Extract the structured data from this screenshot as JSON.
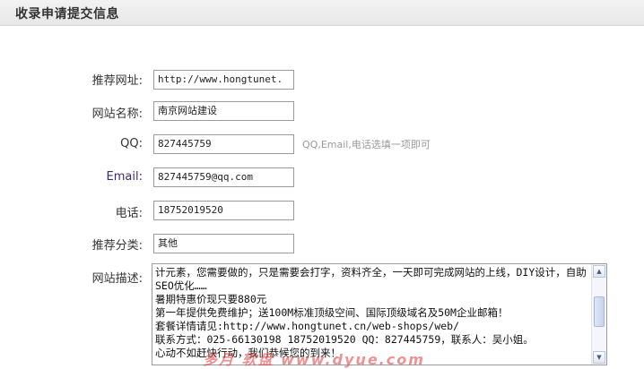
{
  "header": {
    "title": "收录申请提交信息"
  },
  "form": {
    "url": {
      "label": "推荐网址:",
      "value": "http://www.hongtunet."
    },
    "name": {
      "label": "网站名称:",
      "value": "南京网站建设"
    },
    "qq": {
      "label": "QQ:",
      "value": "827445759",
      "hint": "QQ,Email,电话选填一项即可"
    },
    "email": {
      "label": "Email:",
      "value": "827445759@qq.com"
    },
    "phone": {
      "label": "电话:",
      "value": "18752019520"
    },
    "category": {
      "label": "推荐分类:",
      "value": "其他"
    },
    "description": {
      "label": "网站描述:",
      "value": "计元素，您需要做的，只是需要会打字，资料齐全，一天即可完成网站的上线，DIY设计，自助SEO优化……\n暑期特惠价现只要880元\n第一年提供免费维护；送100M标准顶级空间、国际顶级域名及50M企业邮箱！\n套餐详情请见:http://www.hongtunet.cn/web-shops/web/\n联系方式：025-66130198 18752019520 QQ：827445759，联系人：吴小姐。\n心动不如赶快行动，我们恭候您的到来！"
    }
  },
  "watermark": "多月 软盘 www.dyue.com",
  "colors": {
    "header_bg": "#ececec",
    "label_purple": "#3b2a6b",
    "hint": "#999999",
    "watermark": "#e03a3a"
  }
}
